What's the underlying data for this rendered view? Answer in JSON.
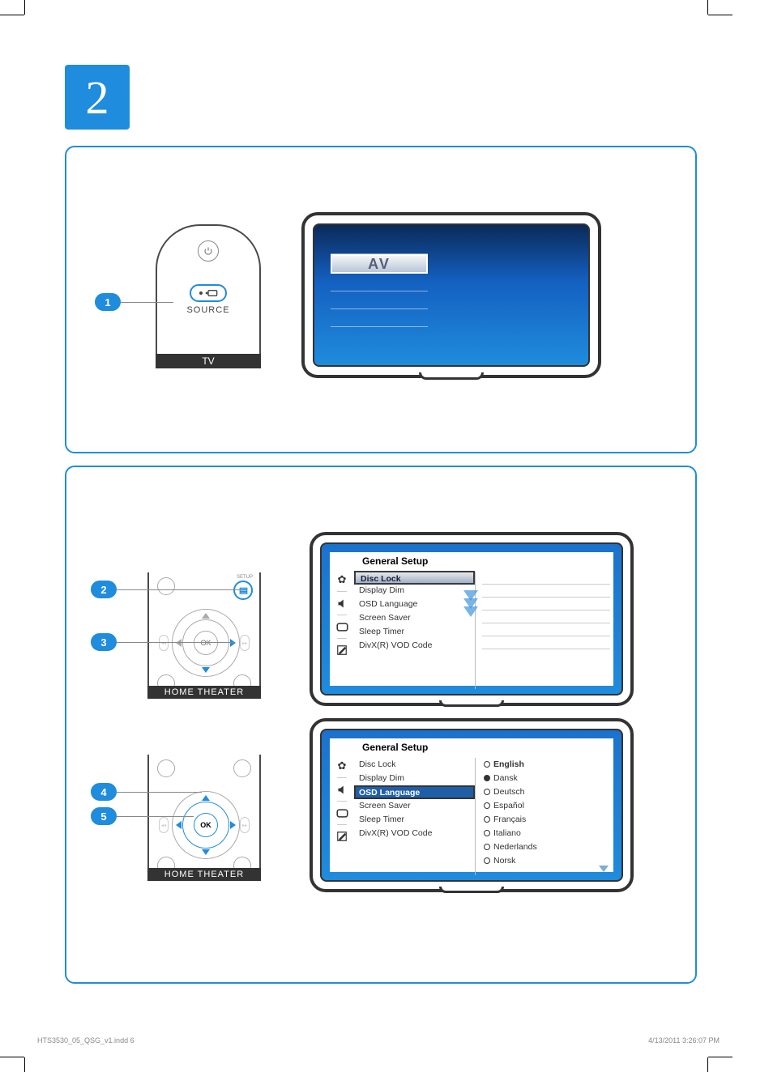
{
  "step_number": "2",
  "bubble": {
    "b1": "1",
    "b2": "2",
    "b3": "3",
    "b4": "4",
    "b5": "5"
  },
  "tv_remote": {
    "label": "TV",
    "source_label": "SOURCE"
  },
  "av_menu": {
    "selected": "AV"
  },
  "ht_remote": {
    "label": "HOME  THEATER",
    "ok": "OK",
    "setup_label": "SETUP"
  },
  "osd": {
    "title": "General Setup",
    "items": {
      "disc_lock": "Disc Lock",
      "display_dim": "Display Dim",
      "osd_language": "OSD Language",
      "screen_saver": "Screen Saver",
      "sleep_timer": "Sleep Timer",
      "divx": "DivX(R) VOD Code"
    },
    "languages": {
      "english": "English",
      "dansk": "Dansk",
      "deutsch": "Deutsch",
      "espanol": "Español",
      "francais": "Français",
      "italiano": "Italiano",
      "nederlands": "Nederlands",
      "norsk": "Norsk"
    }
  },
  "footer": {
    "file": "HTS3530_05_QSG_v1.indd   6",
    "timestamp": "4/13/2011   3:26:07 PM"
  }
}
